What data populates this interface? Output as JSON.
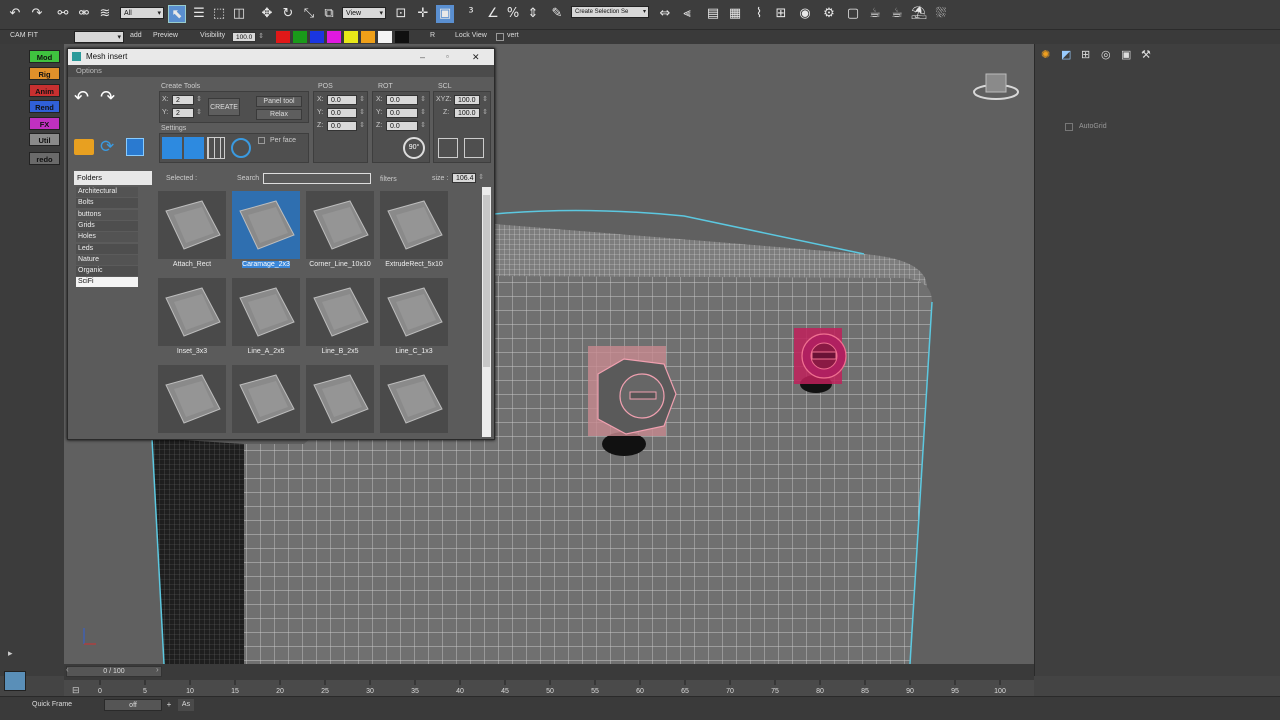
{
  "toolbar": {
    "selection_filter": "All",
    "ref_coord": "View",
    "named_selection": "Create Selection Se",
    "cam_fit": "CAM FIT",
    "add": "add",
    "preview": "Preview",
    "visibility_label": "Visibility",
    "visibility_value": "100.0",
    "r_label": "R",
    "lock_view": "Lock View",
    "vert": "vert",
    "swatch_colors": [
      "#e01818",
      "#1a9a1a",
      "#1a36e0",
      "#e018e0",
      "#e8e818",
      "#f0a018",
      "#f4f4f4",
      "#101010"
    ]
  },
  "left_buttons": [
    {
      "label": "Mod",
      "color": "#3fc23f"
    },
    {
      "label": "Rig",
      "color": "#e0902a"
    },
    {
      "label": "Anim",
      "color": "#c83030"
    },
    {
      "label": "Rend",
      "color": "#3060d8"
    },
    {
      "label": "FX",
      "color": "#c030c0"
    },
    {
      "label": "Util",
      "color": "#8a8a8a"
    },
    {
      "label": "redo",
      "color": "#6a6a6a"
    }
  ],
  "window": {
    "title": "Mesh insert",
    "options": "Options",
    "create_tools": "Create Tools",
    "x_label": "X:",
    "y_label": "Y:",
    "z_label": "Z:",
    "xyz_label": "XYZ:",
    "create_x": "2",
    "create_y": "2",
    "create_btn": "CREATE",
    "panel_tool": "Panel tool",
    "relax": "Relax",
    "pos": "POS",
    "pos_x": "0.0",
    "pos_y": "0.0",
    "pos_z": "0.0",
    "rot": "ROT",
    "rot_x": "0.0",
    "rot_y": "0.0",
    "rot_z": "0.0",
    "scl": "SCL",
    "scl_xyz": "100.0",
    "scl_z": "100.0",
    "settings": "Settings",
    "per_face": "Per face",
    "rot90": "90°",
    "folders_header": "Folders",
    "folders": [
      "Architectural",
      "Bolts",
      "buttons",
      "Grids",
      "Holes",
      "Leds",
      "Nature",
      "Organic",
      "SciFi"
    ],
    "selected_folder": "SciFi",
    "selected_label": "Selected :",
    "search_label": "Search",
    "filters": "filters",
    "size_label": "size :",
    "size_value": "106.4",
    "items": [
      "Attach_Rect",
      "Caramage_2x3",
      "Corner_Line_10x10",
      "ExtrudeRect_5x10",
      "Inset_3x3",
      "Line_A_2x5",
      "Line_B_2x5",
      "Line_C_1x3",
      "",
      "",
      "",
      ""
    ],
    "selected_item": "Caramage_2x3"
  },
  "right_panel": {
    "autogrid": "AutoGrid"
  },
  "timeline": {
    "frame": "0 / 100",
    "ticks": [
      "0",
      "5",
      "10",
      "15",
      "20",
      "25",
      "30",
      "35",
      "40",
      "45",
      "50",
      "55",
      "60",
      "65",
      "70",
      "75",
      "80",
      "85",
      "90",
      "95",
      "100"
    ]
  },
  "status": {
    "quick_frame": "Quick Frame",
    "off": "off",
    "plus": "+",
    "as": "As"
  }
}
